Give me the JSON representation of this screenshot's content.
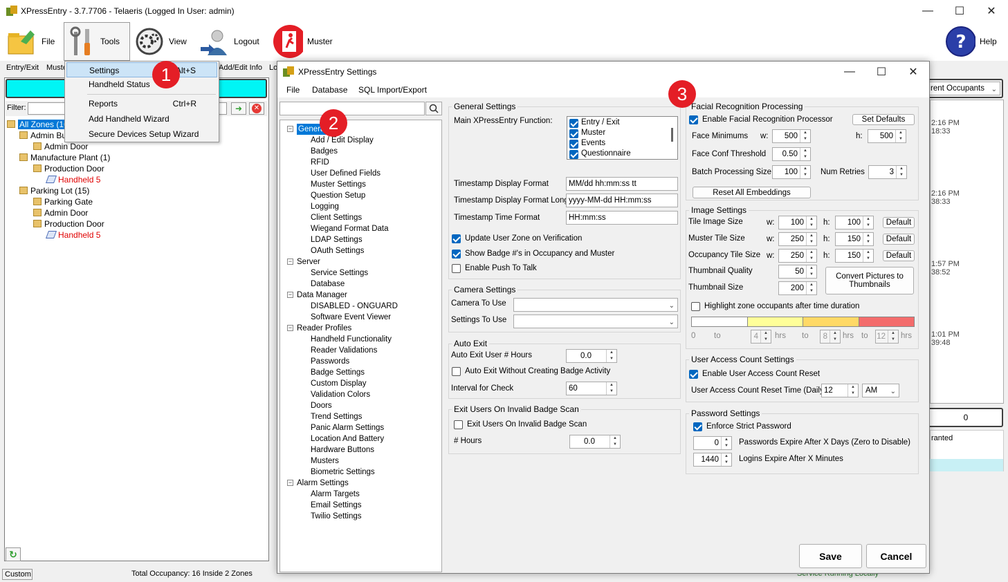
{
  "main": {
    "title": "XPressEntry - 3.7.7706 - Telaeris (Logged In User: admin)",
    "toolbar": [
      {
        "label": "File",
        "icon": "folder-icon"
      },
      {
        "label": "Tools",
        "icon": "tools-icon"
      },
      {
        "label": "View",
        "icon": "gear-icon"
      },
      {
        "label": "Logout",
        "icon": "logout-user-icon"
      },
      {
        "label": "Muster",
        "icon": "exit-running-icon"
      }
    ],
    "help_label": "Help",
    "left_tabs": [
      "Entry/Exit",
      "Muste",
      "Add/Edit Info",
      "Lo"
    ],
    "filter_label": "Filter:",
    "zone_tree": [
      {
        "text": "All Zones (16)",
        "level": 0,
        "selected": true,
        "red": false
      },
      {
        "text": "Admin Bui",
        "level": 1,
        "red": false
      },
      {
        "text": "Admin Door",
        "level": 2,
        "red": false
      },
      {
        "text": "Manufacture Plant (1)",
        "level": 1,
        "red": false
      },
      {
        "text": "Production Door",
        "level": 2,
        "red": false
      },
      {
        "text": "Handheld 5",
        "level": 3,
        "red": true
      },
      {
        "text": "Parking Lot (15)",
        "level": 1,
        "red": false
      },
      {
        "text": "Parking Gate",
        "level": 2,
        "red": false
      },
      {
        "text": "Admin Door",
        "level": 2,
        "red": false
      },
      {
        "text": "Production Door",
        "level": 2,
        "red": false
      },
      {
        "text": "Handheld 5",
        "level": 3,
        "red": true
      }
    ],
    "status": {
      "mode": "Custom",
      "occupancy": "Total Occupancy: 16 Inside 2 Zones",
      "service": "Service Running Locally"
    },
    "right_panel": {
      "occupants_combo": "rent Occupants",
      "times": [
        {
          "a": "2:16 PM",
          "b": "18:33"
        },
        {
          "a": "2:16 PM",
          "b": "38:33"
        },
        {
          "a": "1:57 PM",
          "b": "38:52"
        },
        {
          "a": "1:01 PM",
          "b": "39:48"
        }
      ],
      "count": "0",
      "granted": "ranted"
    }
  },
  "tools_menu": [
    {
      "label": "Settings",
      "shortcut": "Alt+S"
    },
    {
      "label": "Handheld Status",
      "shortcut": ""
    },
    {
      "label": "Reports",
      "shortcut": "Ctrl+R"
    },
    {
      "label": "Add Handheld Wizard",
      "shortcut": ""
    },
    {
      "label": "Secure Devices Setup Wizard",
      "shortcut": ""
    }
  ],
  "badges": [
    "1",
    "2",
    "3"
  ],
  "dialog": {
    "title": "XPressEntry Settings",
    "menu": [
      "File",
      "Database",
      "SQL Import/Export"
    ],
    "tree": [
      {
        "text": "General",
        "level": 0,
        "selected": true
      },
      {
        "text": "Add / Edit Display",
        "level": 1
      },
      {
        "text": "Badges",
        "level": 1
      },
      {
        "text": "RFID",
        "level": 1
      },
      {
        "text": "User Defined Fields",
        "level": 1
      },
      {
        "text": "Muster Settings",
        "level": 1
      },
      {
        "text": "Question Setup",
        "level": 1
      },
      {
        "text": "Logging",
        "level": 1
      },
      {
        "text": "Client Settings",
        "level": 1
      },
      {
        "text": "Wiegand Format Data",
        "level": 1
      },
      {
        "text": "LDAP Settings",
        "level": 1
      },
      {
        "text": "OAuth Settings",
        "level": 1
      },
      {
        "text": "Server",
        "level": 0
      },
      {
        "text": "Service Settings",
        "level": 1
      },
      {
        "text": "Database",
        "level": 1
      },
      {
        "text": "Data Manager",
        "level": 0
      },
      {
        "text": "DISABLED - ONGUARD",
        "level": 1
      },
      {
        "text": "Software Event Viewer",
        "level": 1
      },
      {
        "text": "Reader Profiles",
        "level": 0
      },
      {
        "text": "Handheld Functionality",
        "level": 1
      },
      {
        "text": "Reader Validations",
        "level": 1
      },
      {
        "text": "Passwords",
        "level": 1
      },
      {
        "text": "Badge Settings",
        "level": 1
      },
      {
        "text": "Custom Display",
        "level": 1
      },
      {
        "text": "Validation Colors",
        "level": 1
      },
      {
        "text": "Doors",
        "level": 1
      },
      {
        "text": "Trend Settings",
        "level": 1
      },
      {
        "text": "Panic Alarm Settings",
        "level": 1
      },
      {
        "text": "Location And Battery",
        "level": 1
      },
      {
        "text": "Hardware Buttons",
        "level": 1
      },
      {
        "text": "Musters",
        "level": 1
      },
      {
        "text": "Biometric Settings",
        "level": 1
      },
      {
        "text": "Alarm Settings",
        "level": 0
      },
      {
        "text": "Alarm Targets",
        "level": 1
      },
      {
        "text": "Email Settings",
        "level": 1
      },
      {
        "text": "Twilio Settings",
        "level": 1
      }
    ],
    "general": {
      "title": "General Settings",
      "main_function_label": "Main XPressEntry Function:",
      "functions": [
        "Entry / Exit",
        "Muster",
        "Events",
        "Questionnaire"
      ],
      "ts_display_label": "Timestamp Display Format",
      "ts_display_value": "MM/dd hh:mm:ss tt",
      "ts_long_label": "Timestamp Display Format Long",
      "ts_long_value": "yyyy-MM-dd HH:mm:ss",
      "ts_time_label": "Timestamp Time Format",
      "ts_time_value": "HH:mm:ss",
      "update_zone": "Update User Zone on Verification",
      "show_badge": "Show Badge #'s in Occupancy and Muster",
      "push_talk": "Enable Push To Talk"
    },
    "camera": {
      "title": "Camera Settings",
      "camera_label": "Camera To Use",
      "settings_label": "Settings To Use"
    },
    "auto_exit": {
      "title": "Auto Exit",
      "hours_label": "Auto Exit User # Hours",
      "hours_value": "0.0",
      "without_badge": "Auto Exit Without Creating Badge Activity",
      "interval_label": "Interval for Check",
      "interval_value": "60"
    },
    "invalid_exit": {
      "title": "Exit Users On Invalid Badge Scan",
      "check_label": "Exit Users On Invalid Badge Scan",
      "hours_label": "# Hours",
      "hours_value": "0.0"
    },
    "facial": {
      "title": "Facial Recognition Processing",
      "enable": "Enable Facial Recognition Processor",
      "set_defaults": "Set Defaults",
      "face_min_label": "Face Minimums",
      "w_label": "w:",
      "h_label": "h:",
      "face_min_w": "500",
      "face_min_h": "500",
      "conf_label": "Face Conf Threshold",
      "conf_value": "0.50",
      "batch_label": "Batch Processing Size",
      "batch_value": "100",
      "retries_label": "Num Retries",
      "retries_value": "3",
      "reset_embeddings": "Reset All Embeddings"
    },
    "image": {
      "title": "Image Settings",
      "rows": [
        {
          "label": "Tile Image Size",
          "w": "100",
          "h": "100",
          "btn": "Default"
        },
        {
          "label": "Muster Tile Size",
          "w": "250",
          "h": "150",
          "btn": "Default"
        },
        {
          "label": "Occupancy Tile Size",
          "w": "250",
          "h": "150",
          "btn": "Default"
        }
      ],
      "thumb_quality_label": "Thumbnail Quality",
      "thumb_quality_value": "50",
      "thumb_size_label": "Thumbnail Size",
      "thumb_size_value": "200",
      "convert_btn": "Convert Pictures to Thumbnails",
      "highlight": "Highlight zone occupants after time duration",
      "zero": "0",
      "to": "to",
      "hrs": "hrs",
      "t1": "4",
      "t2": "8",
      "t3": "12",
      "colors": [
        "#ffffff",
        "#ffff99",
        "#ffd966",
        "#f36c6c"
      ]
    },
    "user_access": {
      "title": "User Access Count Settings",
      "enable": "Enable User Access Count Reset",
      "time_label": "User Access Count Reset Time (Daily)",
      "hour": "12",
      "ampm": "AM"
    },
    "password": {
      "title": "Password Settings",
      "strict": "Enforce Strict Password",
      "expire_days": "0",
      "expire_days_label": "Passwords Expire After X Days (Zero to Disable)",
      "expire_min": "1440",
      "expire_min_label": "Logins Expire After X Minutes"
    },
    "save": "Save",
    "cancel": "Cancel"
  }
}
